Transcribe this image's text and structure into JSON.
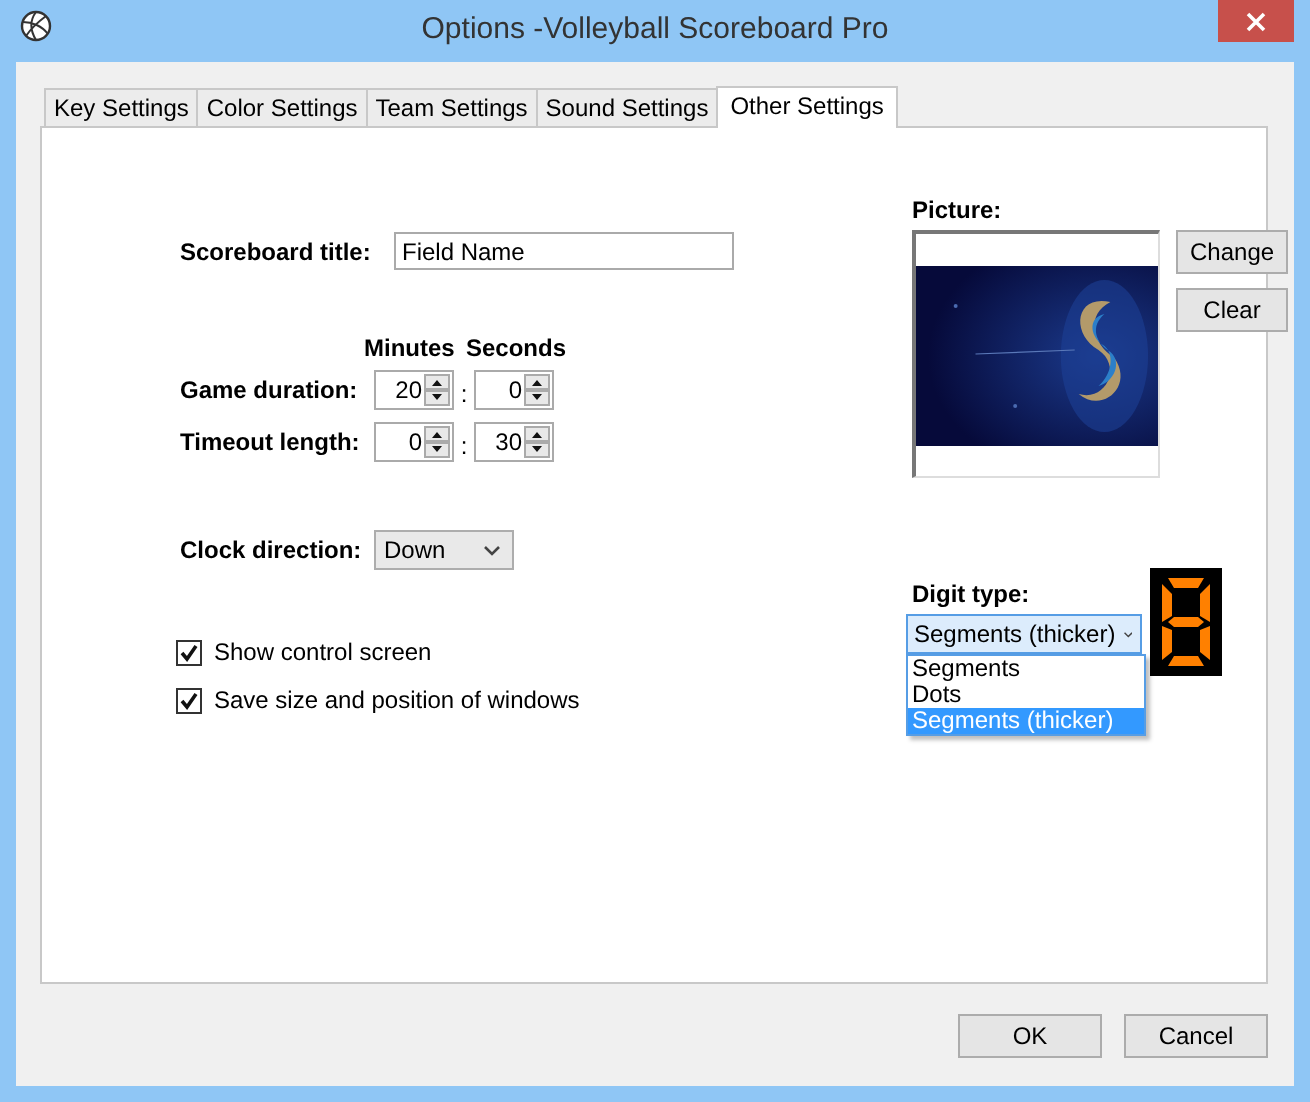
{
  "window": {
    "title": "Options -Volleyball Scoreboard Pro"
  },
  "tabs": [
    {
      "label": "Key Settings",
      "selected": false
    },
    {
      "label": "Color Settings",
      "selected": false
    },
    {
      "label": "Team Settings",
      "selected": false
    },
    {
      "label": "Sound Settings",
      "selected": false
    },
    {
      "label": "Other Settings",
      "selected": true
    }
  ],
  "scoreboard_title": {
    "label": "Scoreboard title:",
    "value": "Field Name"
  },
  "time_headers": [
    "Minutes",
    "Seconds"
  ],
  "time_rows": [
    {
      "label": "Game duration:",
      "minutes": "20",
      "separator": ":",
      "seconds": "0"
    },
    {
      "label": "Timeout length:",
      "minutes": "0",
      "separator": ":",
      "seconds": "30"
    }
  ],
  "clock_direction": {
    "label": "Clock direction:",
    "value": "Down"
  },
  "checkboxes": [
    {
      "label": "Show control screen",
      "checked": true
    },
    {
      "label": "Save size and position of windows",
      "checked": true
    }
  ],
  "picture": {
    "label": "Picture:",
    "buttons": [
      "Change",
      "Clear"
    ]
  },
  "digit_type": {
    "label": "Digit type:",
    "value": "Segments (thicker)",
    "expanded": true,
    "options": [
      {
        "label": "Segments",
        "selected": false
      },
      {
        "label": "Dots",
        "selected": false
      },
      {
        "label": "Segments (thicker)",
        "selected": true
      }
    ]
  },
  "buttons": [
    "OK",
    "Cancel"
  ]
}
